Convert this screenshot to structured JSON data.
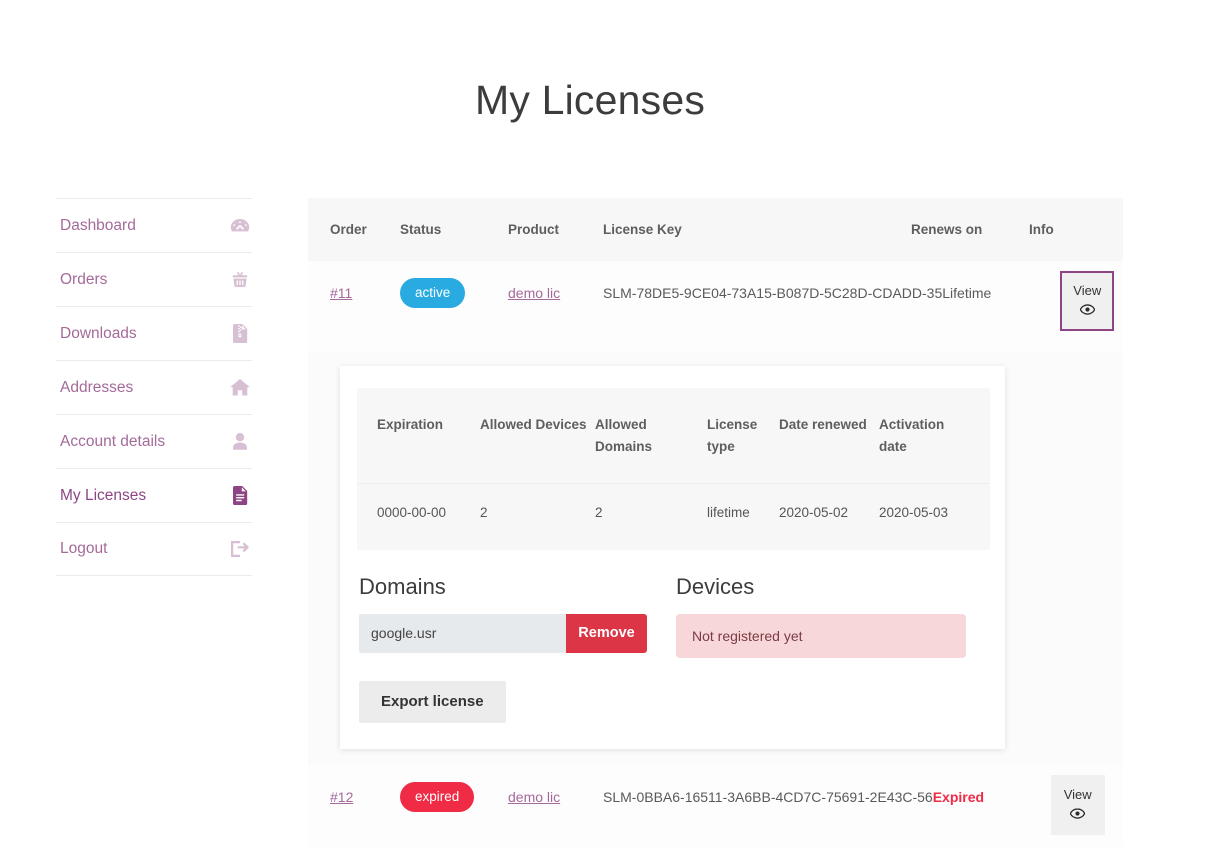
{
  "page": {
    "title": "My Licenses"
  },
  "sidebar": {
    "items": [
      {
        "label": "Dashboard",
        "icon": "dashboard-icon",
        "active": false
      },
      {
        "label": "Orders",
        "icon": "basket-icon",
        "active": false
      },
      {
        "label": "Downloads",
        "icon": "file-zip-icon",
        "active": false
      },
      {
        "label": "Addresses",
        "icon": "home-icon",
        "active": false
      },
      {
        "label": "Account details",
        "icon": "user-icon",
        "active": false
      },
      {
        "label": "My Licenses",
        "icon": "document-icon",
        "active": true
      },
      {
        "label": "Logout",
        "icon": "logout-icon",
        "active": false
      }
    ]
  },
  "licenses_table": {
    "columns": [
      "Order",
      "Status",
      "Product",
      "License Key",
      "Renews on",
      "Info"
    ],
    "rows": [
      {
        "order": "#11",
        "status": "active",
        "status_color": "#29abe2",
        "product": "demo lic",
        "license_key": "SLM-78DE5-9CE04-73A15-B087D-5C28D-CDADD-35",
        "renews_on": "Lifetime",
        "renews_expired": false,
        "info_label": "View",
        "info_icon": "eye-icon",
        "info_focused": true,
        "expanded": true
      },
      {
        "order": "#12",
        "status": "expired",
        "status_color": "#ef2b45",
        "product": "demo lic",
        "license_key": "SLM-0BBA6-16511-3A6BB-4CD7C-75691-2E43C-56",
        "renews_on": "Expired",
        "renews_expired": true,
        "info_label": "View",
        "info_icon": "eye-icon",
        "info_focused": false,
        "expanded": false
      }
    ]
  },
  "detail_panel": {
    "inner_table": {
      "columns": [
        "Expiration",
        "Allowed Devices",
        "Allowed Domains",
        "License type",
        "Date renewed",
        "Activation date"
      ],
      "row": {
        "expiration": "0000-00-00",
        "allowed_devices": "2",
        "allowed_domains": "2",
        "license_type": "lifetime",
        "date_renewed": "2020-05-02",
        "activation_date": "2020-05-03"
      }
    },
    "domains": {
      "heading": "Domains",
      "value": "google.usr",
      "placeholder": "",
      "remove_label": "Remove"
    },
    "devices": {
      "heading": "Devices",
      "empty_message": "Not registered yet"
    },
    "export_label": "Export license"
  },
  "colors": {
    "accent_purple": "#8e4585",
    "link_purple": "#a46a9a",
    "status_active": "#29abe2",
    "status_expired": "#ef2b45",
    "danger": "#dc3545",
    "devices_bg": "#f8d7da"
  }
}
